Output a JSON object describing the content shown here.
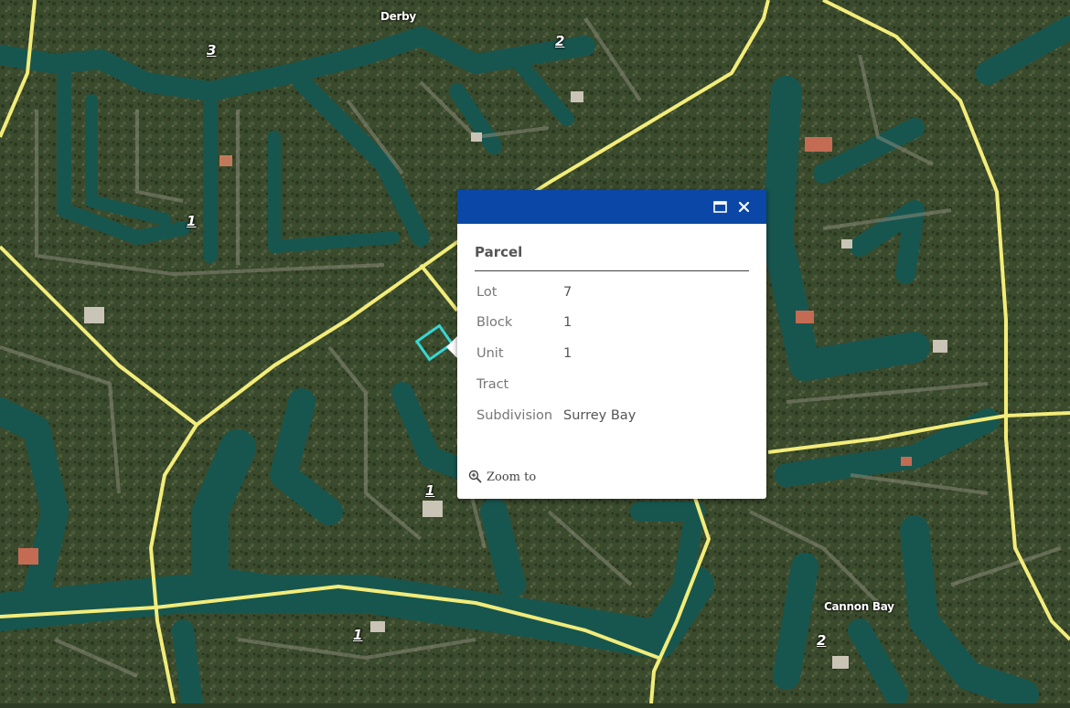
{
  "map": {
    "place_labels": [
      {
        "text": "Derby",
        "id": "derby"
      },
      {
        "text": "Cannon Bay",
        "id": "cannon-bay"
      }
    ],
    "lot_labels": [
      "3",
      "2",
      "1",
      "1",
      "1",
      "2"
    ]
  },
  "popup": {
    "maximize_icon": "maximize-icon",
    "close_icon": "close-icon",
    "title": "Parcel",
    "fields": [
      {
        "label": "Lot",
        "value": "7"
      },
      {
        "label": "Block",
        "value": "1"
      },
      {
        "label": "Unit",
        "value": "1"
      },
      {
        "label": "Tract",
        "value": ""
      },
      {
        "label": "Subdivision",
        "value": "Surrey Bay"
      }
    ],
    "zoom_label": "Zoom to",
    "zoom_icon": "zoom-in-icon"
  },
  "colors": {
    "header": "#0a47a6",
    "road": "#f2ec7a",
    "water": "#17564f",
    "selection": "#37d6d4"
  }
}
